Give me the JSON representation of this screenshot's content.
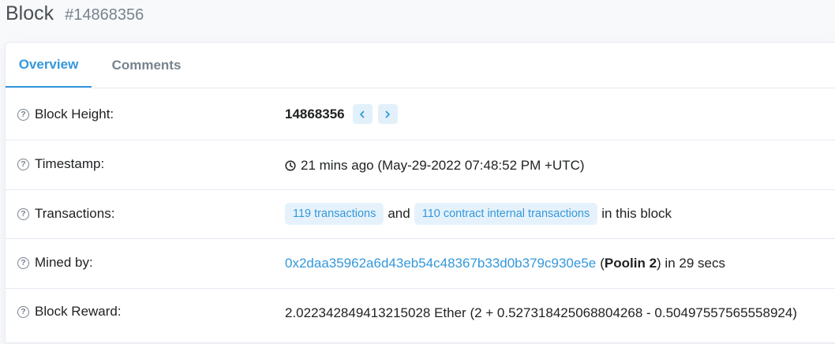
{
  "header": {
    "title": "Block",
    "block_number": "#14868356"
  },
  "tabs": [
    {
      "label": "Overview",
      "active": true
    },
    {
      "label": "Comments",
      "active": false
    }
  ],
  "rows": {
    "block_height": {
      "label": "Block Height:",
      "value": "14868356"
    },
    "timestamp": {
      "label": "Timestamp:",
      "value": "21 mins ago (May-29-2022 07:48:52 PM +UTC)"
    },
    "transactions": {
      "label": "Transactions:",
      "tx_badge": "119 transactions",
      "and_text": "and",
      "internal_badge": "110 contract internal transactions",
      "suffix": "in this block"
    },
    "mined_by": {
      "label": "Mined by:",
      "address": "0x2daa35962a6d43eb54c48367b33d0b379c930e5e",
      "paren_open": "(",
      "miner_name": "Poolin 2",
      "suffix": ") in 29 secs"
    },
    "block_reward": {
      "label": "Block Reward:",
      "value": "2.022342849413215028 Ether (2 + 0.527318425068804268 - 0.50497557565558924)"
    }
  },
  "colors": {
    "accent": "#3498db",
    "muted": "#77838f",
    "border": "#e7eaf3"
  }
}
